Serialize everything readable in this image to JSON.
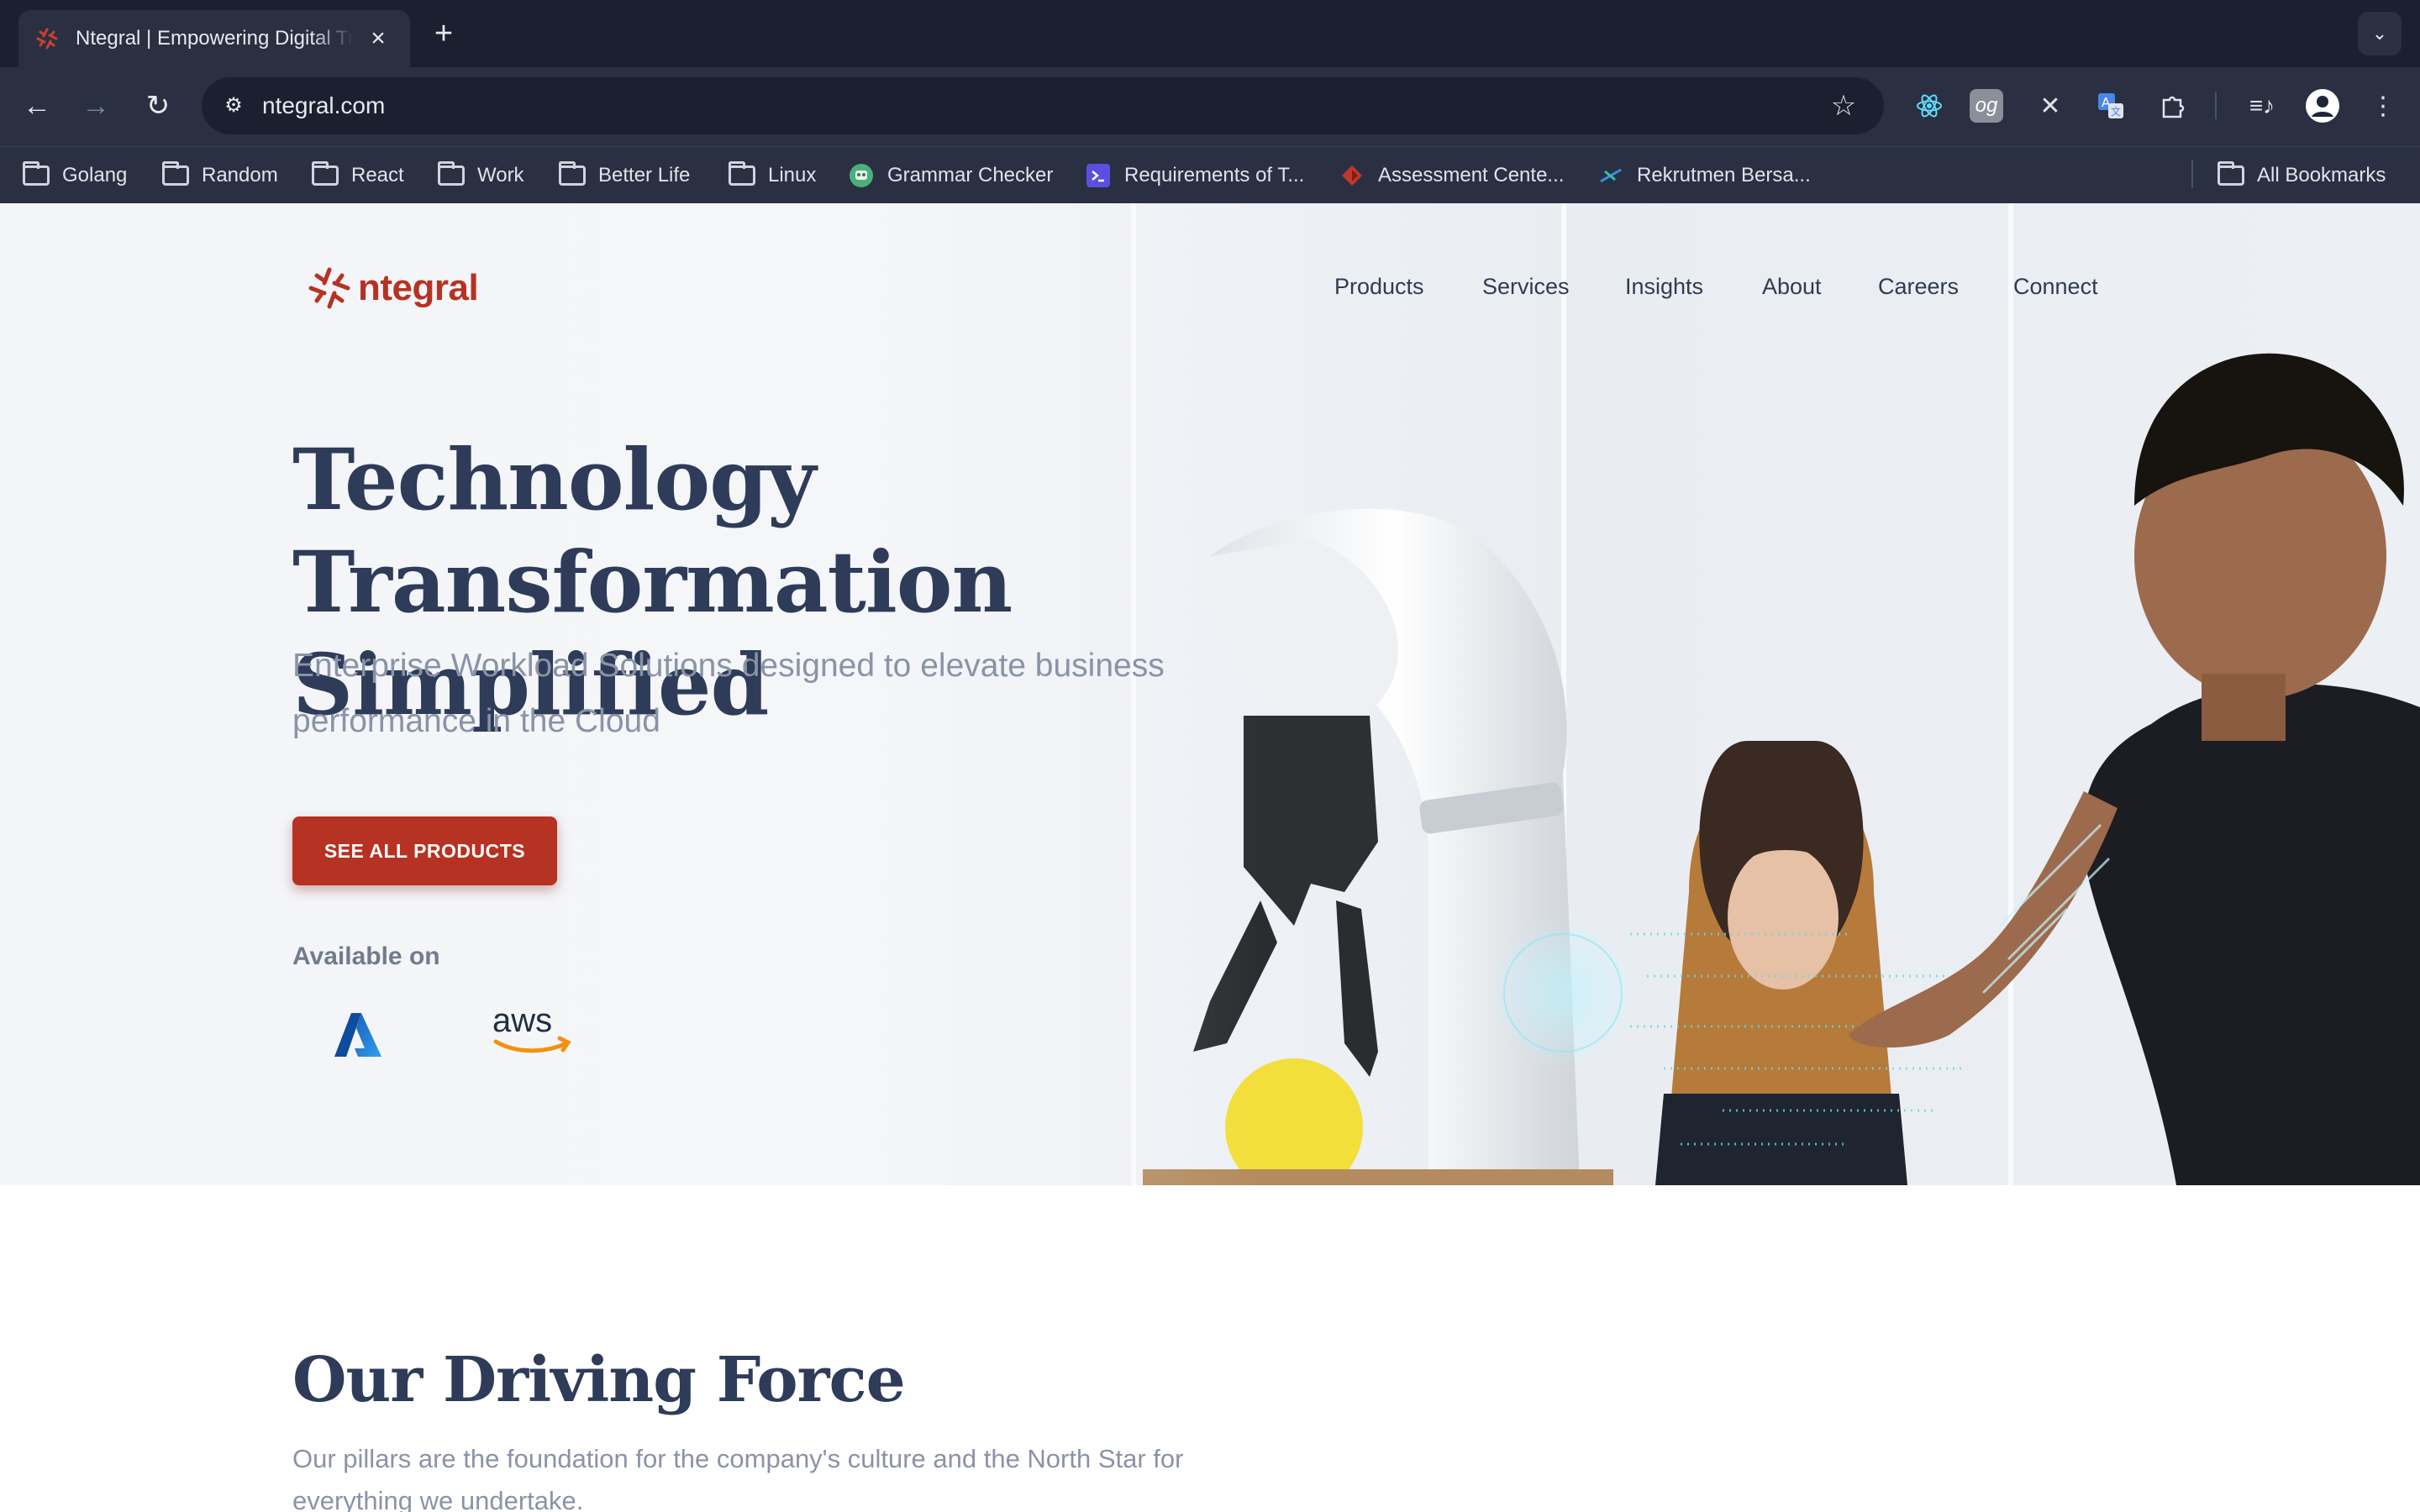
{
  "browser": {
    "tab_title": "Ntegral | Empowering Digital Transformation",
    "url": "ntegral.com",
    "bookmarks": [
      {
        "label": "Golang",
        "icon": "folder-icon"
      },
      {
        "label": "Random",
        "icon": "folder-icon"
      },
      {
        "label": "React",
        "icon": "folder-icon"
      },
      {
        "label": "Work",
        "icon": "folder-icon"
      },
      {
        "label": "Better Life",
        "icon": "folder-icon"
      },
      {
        "label": "Linux",
        "icon": "folder-icon"
      },
      {
        "label": "Grammar Checker",
        "icon": "robot-favicon"
      },
      {
        "label": "Requirements of T...",
        "icon": "terminal-favicon"
      },
      {
        "label": "Assessment Cente...",
        "icon": "red-favicon"
      },
      {
        "label": "Rekrutmen Bersa...",
        "icon": "plane-favicon"
      }
    ],
    "all_bookmarks": "All Bookmarks"
  },
  "site": {
    "logo_text": "ntegral",
    "nav": [
      "Products",
      "Services",
      "Insights",
      "About",
      "Careers",
      "Connect"
    ],
    "hero": {
      "headline_line1": "Technology Transformation",
      "headline_line2": "Simplified",
      "subtitle": "Enterprise Workload Solutions designed to elevate business performance in the Cloud",
      "cta": "SEE ALL PRODUCTS",
      "available_on": "Available on",
      "aws_text": "aws"
    },
    "section": {
      "title": "Our Driving Force",
      "subtitle": "Our pillars are the foundation for the company's culture and the North Star for everything we undertake."
    }
  },
  "colors": {
    "brand_red": "#b63223",
    "heading_navy": "#2e3c5a",
    "chrome_dark": "#1f2536"
  }
}
